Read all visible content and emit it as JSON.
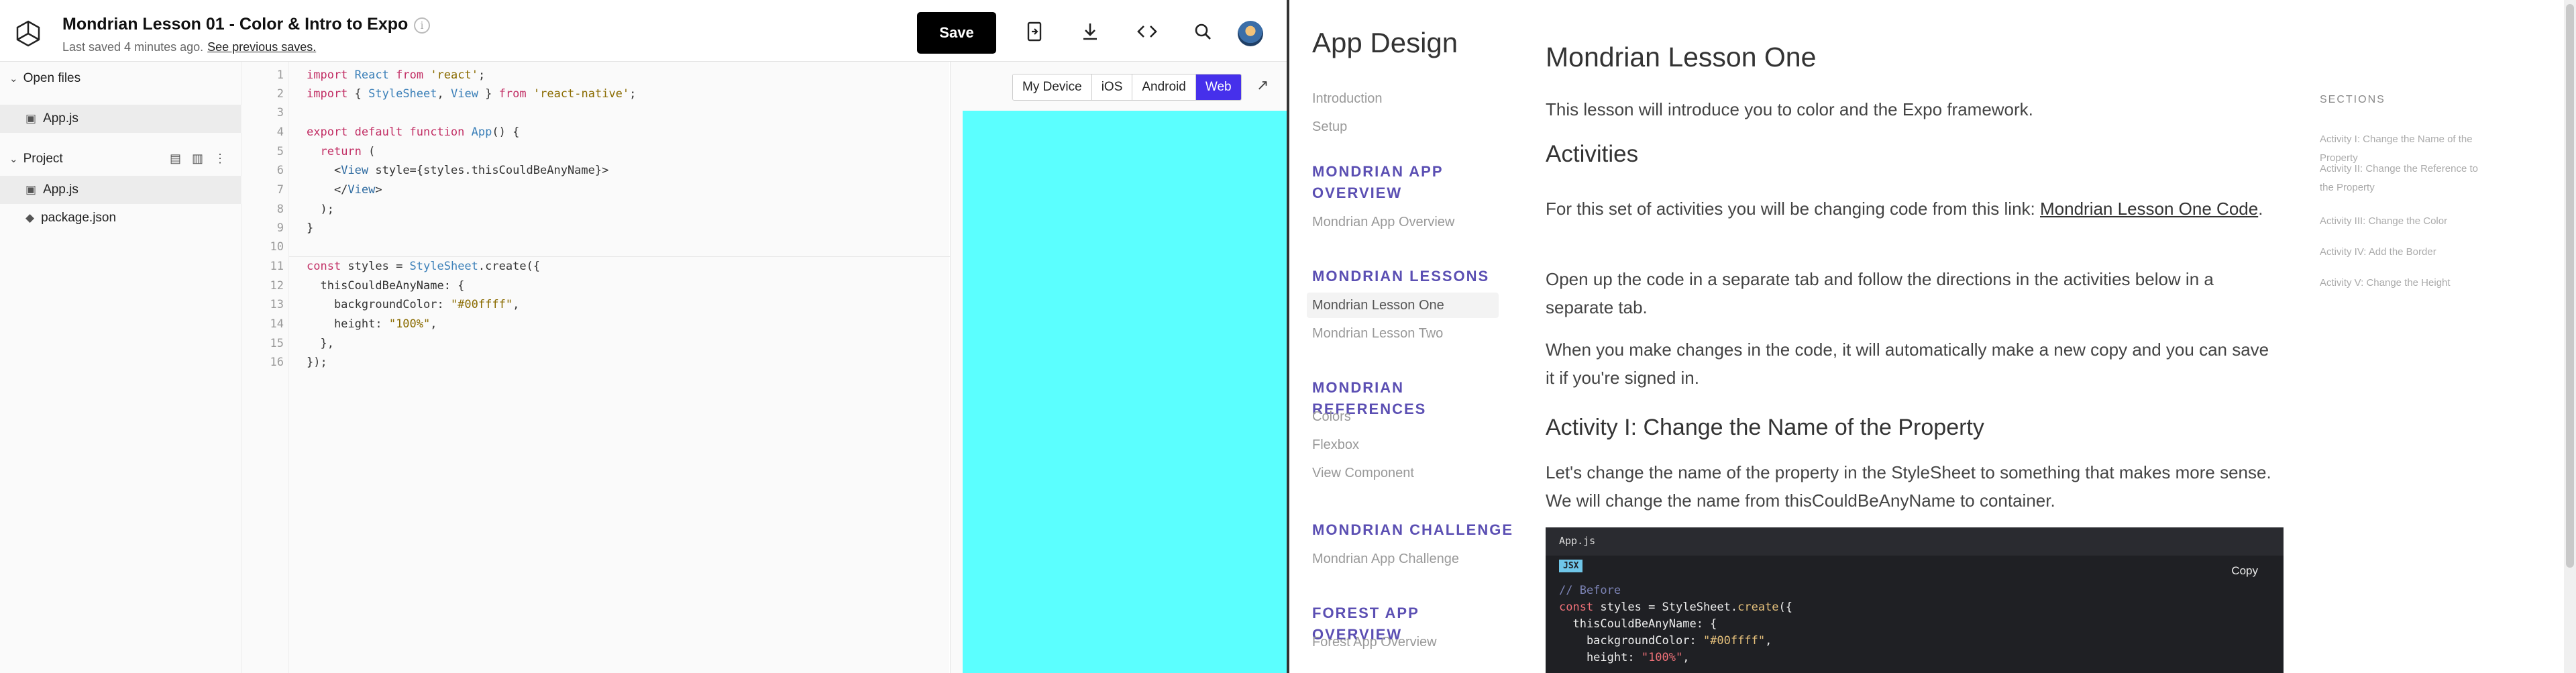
{
  "header": {
    "title": "Mondrian Lesson 01 -  Color & Intro to Expo",
    "saved_text": "Last saved 4 minutes ago.",
    "saved_link": "See previous saves.",
    "save_label": "Save"
  },
  "sidebar": {
    "open_files_label": "Open files",
    "open_files": [
      "App.js"
    ],
    "project_label": "Project",
    "project_files": [
      "App.js",
      "package.json"
    ]
  },
  "editor": {
    "line_numbers": [
      "1",
      "2",
      "3",
      "4",
      "5",
      "6",
      "7",
      "8",
      "9",
      "10",
      "11",
      "12",
      "13",
      "14",
      "15",
      "16"
    ]
  },
  "preview": {
    "tabs": [
      "My Device",
      "iOS",
      "Android",
      "Web"
    ],
    "active_tab": "Web",
    "background_color": "#5bffff"
  },
  "docs": {
    "app_title": "App Design",
    "nav": {
      "intro": "Introduction",
      "setup": "Setup",
      "overview_head": "MONDRIAN APP OVERVIEW",
      "overview_item": "Mondrian App Overview",
      "lessons_head": "MONDRIAN LESSONS",
      "lesson_one": "Mondrian Lesson One",
      "lesson_two": "Mondrian Lesson Two",
      "references_head": "MONDRIAN REFERENCES",
      "colors": "Colors",
      "flexbox": "Flexbox",
      "view_component": "View Component",
      "challenge_head": "MONDRIAN CHALLENGE",
      "challenge_item": "Mondrian App Challenge",
      "forest_head": "FOREST APP OVERVIEW",
      "forest_item": "Forest App Overview"
    },
    "h1": "Mondrian Lesson One",
    "intro_p": "This lesson will introduce you to color and the  Expo framework.",
    "activities_h": "Activities",
    "p1_text": "For this set of activities you will be changing code from this link: ",
    "p1_link": "Mondrian Lesson One Code",
    "p2": "Open up the code in a separate tab and follow the directions in the activities below in a separate tab.",
    "p3": "When you make changes in the code, it will automatically make a new copy and you can save it if you're signed in.",
    "activity1_h": "Activity  I: Change the  Name of the  Property",
    "activity1_p": "Let's change the name of the property in the StyleSheet to something that makes more sense. We will change the name from thisCouldBeAnyName to container.",
    "code_file": "App.js",
    "code_lang": "JSX",
    "copy_label": "Copy",
    "sections_label": "SECTIONS",
    "toc": [
      "Activity  I: Change the  Name of the  Property",
      "Activity  II: Change the  Reference to the  Property",
      "Activity  III: Change the  Color",
      "Activity  IV: Add the  Border",
      "Activity V: Change the  Height"
    ]
  }
}
